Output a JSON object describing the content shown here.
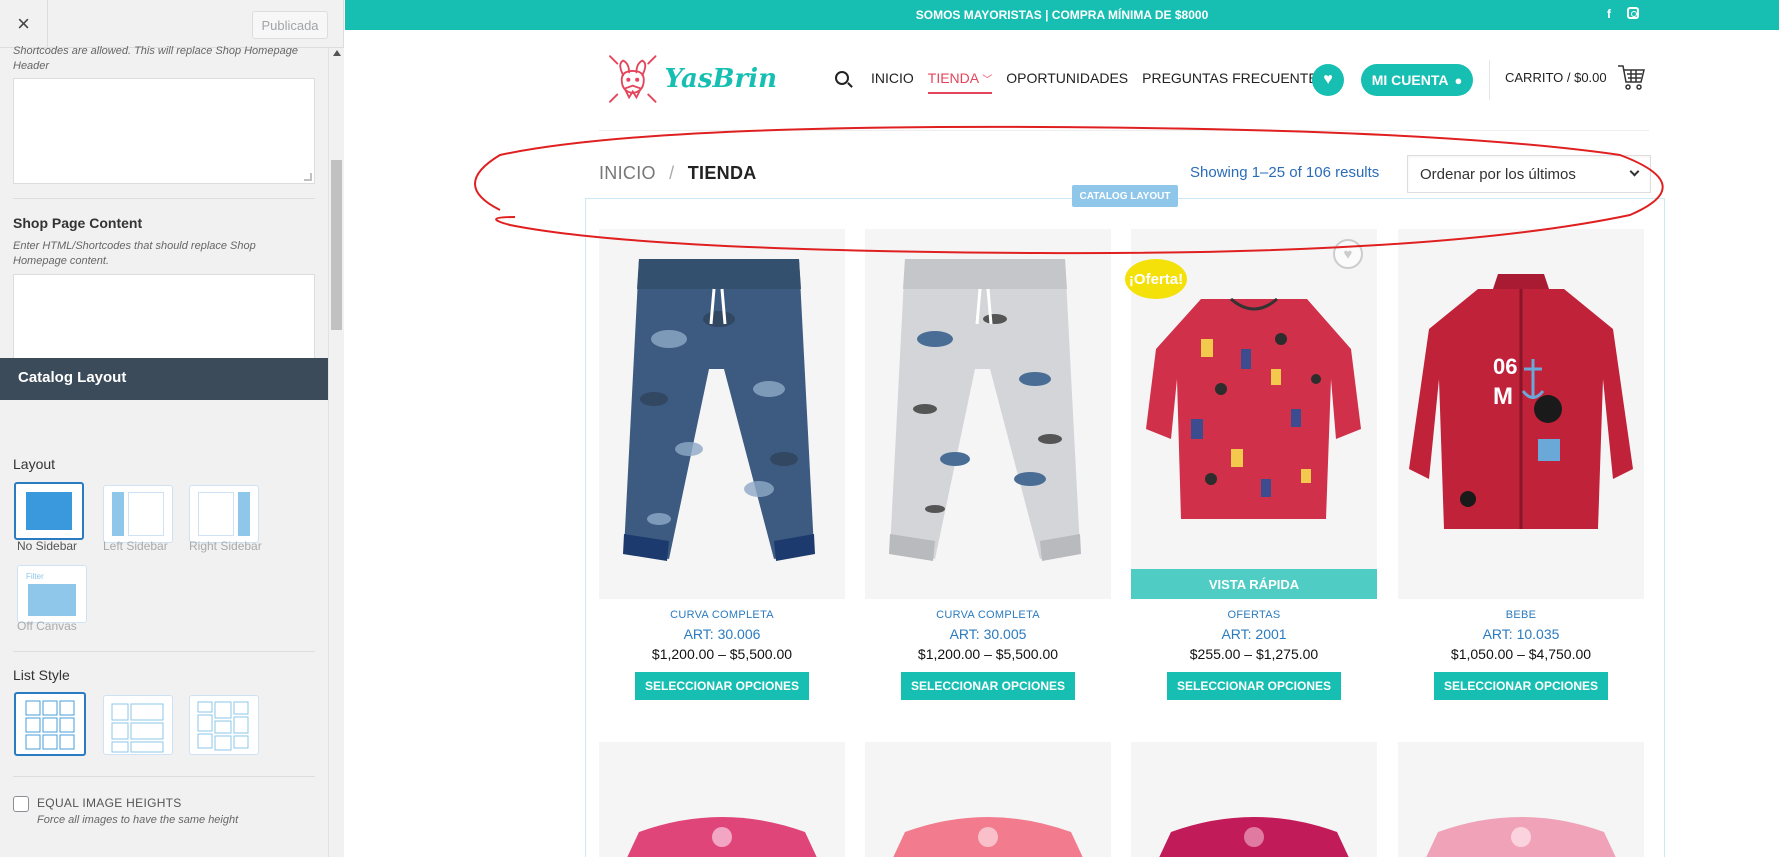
{
  "panel": {
    "close_icon": "×",
    "publish_label": "Publicada",
    "header_desc": "Shortcodes are allowed. This will replace Shop Homepage Header",
    "content_title": "Shop Page Content",
    "content_desc": "Enter HTML/Shortcodes that should replace Shop Homepage content.",
    "catalog_title": "Catalog Layout",
    "layout_title": "Layout",
    "layout_options": [
      {
        "label": "No Sidebar",
        "selected": true
      },
      {
        "label": "Left Sidebar",
        "selected": false
      },
      {
        "label": "Right Sidebar",
        "selected": false
      },
      {
        "label": "Off Canvas",
        "selected": false
      }
    ],
    "filter_tag": "Filter",
    "list_style_title": "List Style",
    "equal_heights_label": "EQUAL IMAGE HEIGHTS",
    "equal_heights_desc": "Force all images to have the same height",
    "equal_heights_checked": false
  },
  "site": {
    "topbar_text": "SOMOS MAYORISTAS | COMPRA MÍNIMA DE $8000",
    "social": [
      "facebook-icon",
      "instagram-icon"
    ],
    "logo_text": "YasBrin",
    "nav": [
      {
        "label": "INICIO",
        "active": false
      },
      {
        "label": "TIENDA",
        "active": true
      },
      {
        "label": "OPORTUNIDADES",
        "active": false
      },
      {
        "label": "PREGUNTAS FRECUENTES",
        "active": false
      }
    ],
    "account_label": "MI CUENTA",
    "cart_label": "CARRITO / $0.00",
    "breadcrumb": {
      "home": "INICIO",
      "sep": "/",
      "current": "TIENDA"
    },
    "results_text": "Showing 1–25 of 106 results",
    "sort_value": "Ordenar por los últimos",
    "layout_tag": "CATALOG LAYOUT",
    "accent_color": "#17bfb3",
    "products": [
      {
        "category": "CURVA COMPLETA",
        "name": "ART: 30.006",
        "price": "$1,200.00 – $5,500.00",
        "button": "SELECCIONAR OPCIONES"
      },
      {
        "category": "CURVA COMPLETA",
        "name": "ART: 30.005",
        "price": "$1,200.00 – $5,500.00",
        "button": "SELECCIONAR OPCIONES"
      },
      {
        "category": "OFERTAS",
        "name": "ART: 2001",
        "price": "$255.00 – $1,275.00",
        "button": "SELECCIONAR OPCIONES",
        "badge": "¡Oferta!",
        "quick_view": "VISTA RÁPIDA"
      },
      {
        "category": "BEBE",
        "name": "ART: 10.035",
        "price": "$1,050.00 – $4,750.00",
        "button": "SELECCIONAR OPCIONES"
      }
    ]
  }
}
